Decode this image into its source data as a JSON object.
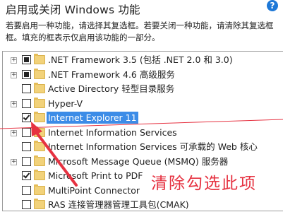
{
  "window": {
    "title": "启用或关闭 Windows 功能",
    "help_icon": "?"
  },
  "description": {
    "line1": "若要启用一种功能，请选择其复选框。若要关闭一种功能，请清除其复选框",
    "line2": "框。填充的框表示仅启用该功能的一部分。"
  },
  "features": [
    {
      "label": ".NET Framework 3.5 (包括 .NET 2.0 和 3.0)",
      "expandable": true,
      "state": "partial",
      "selected": false
    },
    {
      "label": ".NET Framework 4.6 高级服务",
      "expandable": true,
      "state": "partial",
      "selected": false
    },
    {
      "label": "Active Directory 轻型目录服务",
      "expandable": false,
      "state": "unchecked",
      "selected": false
    },
    {
      "label": "Hyper-V",
      "expandable": true,
      "state": "unchecked",
      "selected": false
    },
    {
      "label": "Internet Explorer 11",
      "expandable": false,
      "state": "checked",
      "selected": true
    },
    {
      "label": "Internet Information Services",
      "expandable": true,
      "state": "unchecked",
      "selected": false
    },
    {
      "label": "Internet Information Services 可承载的 Web 核心",
      "expandable": false,
      "state": "unchecked",
      "selected": false
    },
    {
      "label": "Microsoft Message Queue (MSMQ) 服务器",
      "expandable": true,
      "state": "unchecked",
      "selected": false
    },
    {
      "label": "Microsoft Print to PDF",
      "expandable": false,
      "state": "checked",
      "selected": false
    },
    {
      "label": "MultiPoint Connector",
      "expandable": false,
      "state": "unchecked",
      "selected": false
    },
    {
      "label": "RAS 连接管理器管理工具包(CMAK)",
      "expandable": false,
      "state": "unchecked",
      "selected": false
    }
  ],
  "annotation": {
    "text": "清除勾选此项",
    "color": "#e63241"
  },
  "colors": {
    "selection": "#3c8ce7",
    "folder": "#f2d27a"
  }
}
